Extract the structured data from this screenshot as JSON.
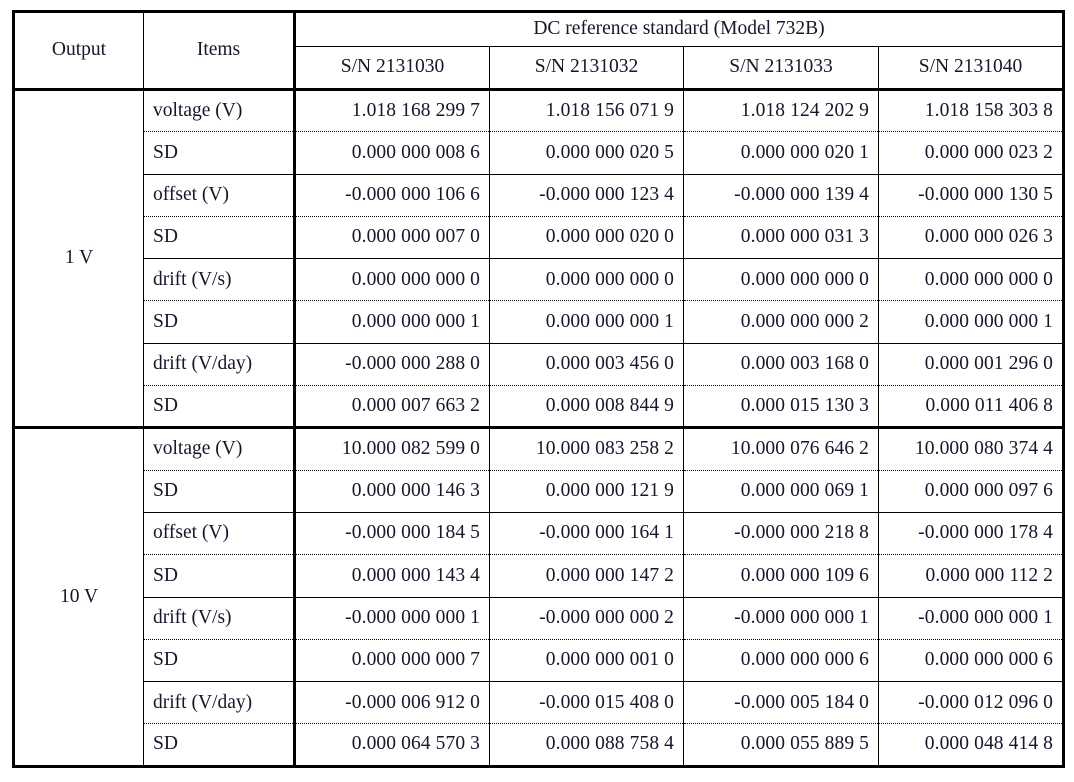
{
  "table": {
    "caption_visible": false,
    "stub_headers": {
      "output": "Output",
      "items": "Items"
    },
    "group_header": "DC reference standard (Model 732B)",
    "unit_columns": [
      "S/N 2131030",
      "S/N 2131032",
      "S/N 2131033",
      "S/N 2131040"
    ],
    "sections": [
      {
        "output": "1 V",
        "rows": [
          {
            "item": "voltage (V)",
            "sep_after": "dotted",
            "values": [
              "1.018 168 299 7",
              "1.018 156 071 9",
              "1.018 124 202 9",
              "1.018 158 303 8"
            ]
          },
          {
            "item": "SD",
            "sep_after": "solid",
            "values": [
              "0.000 000 008 6",
              "0.000 000 020 5",
              "0.000 000 020 1",
              "0.000 000 023 2"
            ]
          },
          {
            "item": "offset (V)",
            "sep_after": "dotted",
            "values": [
              "-0.000 000 106 6",
              "-0.000 000 123 4",
              "-0.000 000 139 4",
              "-0.000 000 130 5"
            ]
          },
          {
            "item": "SD",
            "sep_after": "solid",
            "values": [
              "0.000 000 007 0",
              "0.000 000 020 0",
              "0.000 000 031 3",
              "0.000 000 026 3"
            ]
          },
          {
            "item": "drift (V/s)",
            "sep_after": "dotted",
            "values": [
              "0.000 000 000 0",
              "0.000 000 000 0",
              "0.000 000 000 0",
              "0.000 000 000 0"
            ]
          },
          {
            "item": "SD",
            "sep_after": "solid",
            "values": [
              "0.000 000 000 1",
              "0.000 000 000 1",
              "0.000 000 000 2",
              "0.000 000 000 1"
            ]
          },
          {
            "item": "drift (V/day)",
            "sep_after": "dotted",
            "values": [
              "-0.000 000 288 0",
              "0.000 003 456 0",
              "0.000 003 168 0",
              "0.000 001 296 0"
            ]
          },
          {
            "item": "SD",
            "sep_after": "thick",
            "values": [
              "0.000 007 663 2",
              "0.000 008 844 9",
              "0.000 015 130 3",
              "0.000 011 406 8"
            ]
          }
        ]
      },
      {
        "output": "10 V",
        "rows": [
          {
            "item": "voltage (V)",
            "sep_after": "dotted",
            "values": [
              "10.000 082 599 0",
              "10.000 083 258 2",
              "10.000 076 646 2",
              "10.000 080 374 4"
            ]
          },
          {
            "item": "SD",
            "sep_after": "solid",
            "values": [
              "0.000 000 146 3",
              "0.000 000 121 9",
              "0.000 000 069 1",
              "0.000 000 097 6"
            ]
          },
          {
            "item": "offset (V)",
            "sep_after": "dotted",
            "values": [
              "-0.000 000 184 5",
              "-0.000 000 164 1",
              "-0.000 000 218 8",
              "-0.000 000 178 4"
            ]
          },
          {
            "item": "SD",
            "sep_after": "solid",
            "values": [
              "0.000 000 143 4",
              "0.000 000 147 2",
              "0.000 000 109 6",
              "0.000 000 112 2"
            ]
          },
          {
            "item": "drift (V/s)",
            "sep_after": "dotted",
            "values": [
              "-0.000 000 000 1",
              "-0.000 000 000 2",
              "-0.000 000 000 1",
              "-0.000 000 000 1"
            ]
          },
          {
            "item": "SD",
            "sep_after": "solid",
            "values": [
              "0.000 000 000 7",
              "0.000 000 001 0",
              "0.000 000 000 6",
              "0.000 000 000 6"
            ]
          },
          {
            "item": "drift (V/day)",
            "sep_after": "dotted",
            "values": [
              "-0.000 006 912 0",
              "-0.000 015 408 0",
              "-0.000 005 184 0",
              "-0.000 012 096 0"
            ]
          },
          {
            "item": "SD",
            "sep_after": "none",
            "values": [
              "0.000 064 570 3",
              "0.000 088 758 4",
              "0.000 055 889 5",
              "0.000 048 414 8"
            ]
          }
        ]
      }
    ]
  }
}
